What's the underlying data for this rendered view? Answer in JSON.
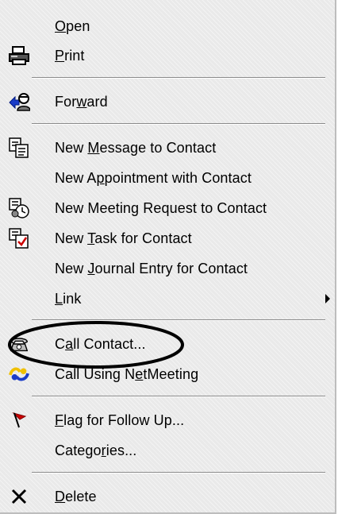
{
  "menu": {
    "items": [
      {
        "pre": "",
        "u": "O",
        "post": "pen"
      },
      {
        "pre": "",
        "u": "P",
        "post": "rint"
      },
      {
        "pre": "For",
        "u": "w",
        "post": "ard"
      },
      {
        "pre": "New ",
        "u": "M",
        "post": "essage to Contact"
      },
      {
        "pre": "New A",
        "u": "p",
        "post": "pointment with Contact"
      },
      {
        "pre": "New Meetin",
        "u": "g",
        "post": " Request to Contact"
      },
      {
        "pre": "New ",
        "u": "T",
        "post": "ask for Contact"
      },
      {
        "pre": "New ",
        "u": "J",
        "post": "ournal Entry for Contact"
      },
      {
        "pre": "",
        "u": "L",
        "post": "ink"
      },
      {
        "pre": "C",
        "u": "a",
        "post": "ll Contact..."
      },
      {
        "pre": "Call Using N",
        "u": "e",
        "post": "tMeeting"
      },
      {
        "pre": "",
        "u": "F",
        "post": "lag for Follow Up..."
      },
      {
        "pre": "Catego",
        "u": "r",
        "post": "ies..."
      },
      {
        "pre": "",
        "u": "D",
        "post": "elete"
      }
    ]
  },
  "icons": {
    "print": "printer-icon",
    "forward": "forward-contact-icon",
    "new_message": "new-message-icon",
    "new_meeting": "meeting-request-icon",
    "new_task": "task-icon",
    "call_contact": "phone-icon",
    "netmeeting": "netmeeting-icon",
    "flag": "flag-icon",
    "delete": "delete-x-icon",
    "link_submenu": "submenu-arrow-icon"
  },
  "colors": {
    "menu_bg": "#e9e9e9",
    "flag_red": "#cc0000",
    "annotation": "#000000"
  }
}
